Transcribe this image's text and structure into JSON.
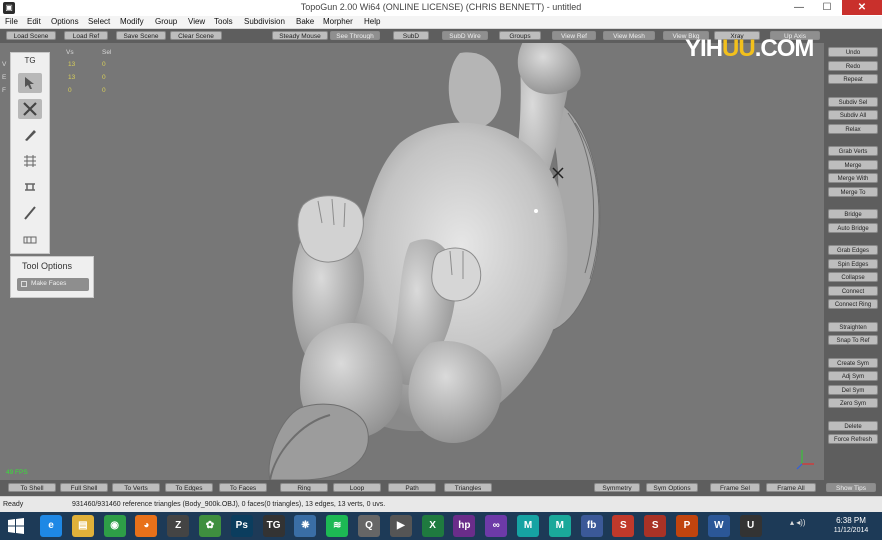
{
  "window": {
    "title": "TopoGun 2.00 Wi64  (ONLINE LICENSE) (CHRIS BENNETT) - untitled",
    "minimize": "—",
    "maximize": "☐",
    "close": "✕"
  },
  "menu": [
    "File",
    "Edit",
    "Options",
    "Select",
    "Modify",
    "Group",
    "View",
    "Tools",
    "Subdivision",
    "Bake",
    "Morpher",
    "Help"
  ],
  "toolbar": {
    "buttons": [
      "Load Scene",
      "Load Ref",
      "Save Scene",
      "Clear Scene",
      "Steady Mouse",
      "See Through",
      "SubD",
      "SubD Wire",
      "Groups",
      "View Ref",
      "View Mesh",
      "View Bkg",
      "Xray",
      "Up Axis"
    ],
    "active": [
      "See Through",
      "SubD Wire",
      "View Ref",
      "View Mesh",
      "View Bkg",
      "Up Axis"
    ]
  },
  "stats": {
    "col_vs": "Vs",
    "col_sel": "Sel",
    "rows": [
      {
        "label": "V",
        "vs": "13",
        "sel": "0"
      },
      {
        "label": "E",
        "vs": "13",
        "sel": "0"
      },
      {
        "label": "F",
        "vs": "0",
        "sel": "0"
      }
    ]
  },
  "fps": "49 FPS",
  "tg_panel": {
    "title": "TG",
    "tools": [
      "select-tool-icon",
      "create-tool-icon",
      "draw-tool-icon",
      "tubes-tool-icon",
      "bridge-tool-icon",
      "brush-tool-icon",
      "paint-tool-icon"
    ]
  },
  "tool_options": {
    "title": "Tool Options",
    "make_faces": "Make Faces"
  },
  "watermark": {
    "part1": "YI",
    "part2": "H",
    "part3": "U",
    "part4": "U",
    "part5": ".COM"
  },
  "right_panel": {
    "groups": [
      [
        "Undo",
        "Redo",
        "Repeat"
      ],
      [
        "Subdiv Sel",
        "Subdiv All",
        "Relax"
      ],
      [
        "Grab Verts",
        "Merge",
        "Merge With",
        "Merge To"
      ],
      [
        "Bridge",
        "Auto Bridge"
      ],
      [
        "Grab Edges",
        "Spin Edges",
        "Collapse",
        "Connect",
        "Connect Ring"
      ],
      [
        "Straighten",
        "Snap To Ref"
      ],
      [
        "Create Sym",
        "Adj Sym",
        "Del Sym",
        "Zero Sym"
      ],
      [
        "Delete",
        "Force Refresh"
      ]
    ]
  },
  "bottom_bar": {
    "left": [
      "To Shell",
      "Full Shell",
      "To Verts",
      "To Edges",
      "To Faces",
      "Ring",
      "Loop",
      "Path",
      "Triangles"
    ],
    "right": [
      "Symmetry",
      "Sym Options",
      "Frame Sel",
      "Frame All",
      "Show Tips"
    ]
  },
  "status": {
    "ready": "Ready",
    "info": "931460/931460 reference triangles (Body_900k.OBJ), 0 faces(0 triangles), 13 edges, 13 verts, 0 uvs."
  },
  "taskbar": {
    "icons": [
      {
        "name": "ie-icon",
        "glyph": "e",
        "color": "#1e88e5"
      },
      {
        "name": "explorer-icon",
        "glyph": "▤",
        "color": "#e0b13a"
      },
      {
        "name": "chrome-icon",
        "glyph": "◉",
        "color": "#2e9e47"
      },
      {
        "name": "firefox-icon",
        "glyph": "◕",
        "color": "#e8711a"
      },
      {
        "name": "zbrush-icon",
        "glyph": "Z",
        "color": "#444444"
      },
      {
        "name": "app-green-icon",
        "glyph": "✿",
        "color": "#3f8f3f"
      },
      {
        "name": "photoshop-icon",
        "glyph": "Ps",
        "color": "#0b3d5e"
      },
      {
        "name": "topogun-icon",
        "glyph": "TG",
        "color": "#333333"
      },
      {
        "name": "chat-icon",
        "glyph": "❋",
        "color": "#3a6ea5"
      },
      {
        "name": "spotify-icon",
        "glyph": "≋",
        "color": "#1db954"
      },
      {
        "name": "quicktime-icon",
        "glyph": "Q",
        "color": "#666666"
      },
      {
        "name": "media-icon",
        "glyph": "▶",
        "color": "#555555"
      },
      {
        "name": "excel-icon",
        "glyph": "X",
        "color": "#1f7a3f"
      },
      {
        "name": "hp-icon",
        "glyph": "hp",
        "color": "#6a2d8a"
      },
      {
        "name": "purple-app-icon",
        "glyph": "∞",
        "color": "#6d3aa8"
      },
      {
        "name": "maya-icon",
        "glyph": "M",
        "color": "#16a3a3"
      },
      {
        "name": "maya2-icon",
        "glyph": "M",
        "color": "#1aa89a"
      },
      {
        "name": "fb-icon",
        "glyph": "fb",
        "color": "#3b5998"
      },
      {
        "name": "substance-icon",
        "glyph": "S",
        "color": "#c0392b"
      },
      {
        "name": "substance2-icon",
        "glyph": "S",
        "color": "#a93226"
      },
      {
        "name": "powerpoint-icon",
        "glyph": "P",
        "color": "#c1440e"
      },
      {
        "name": "word-icon",
        "glyph": "W",
        "color": "#2b5797"
      },
      {
        "name": "unreal-icon",
        "glyph": "U",
        "color": "#333333"
      }
    ],
    "clock_time": "6:38 PM",
    "clock_date": "11/12/2014"
  }
}
